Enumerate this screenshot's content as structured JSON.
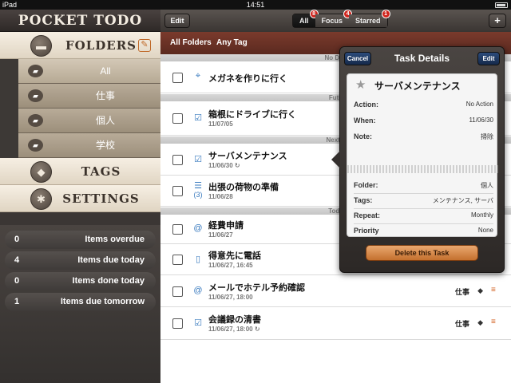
{
  "status": {
    "carrier": "iPad",
    "time": "14:51",
    "battery": ""
  },
  "app": {
    "title": "POCKET TODO"
  },
  "sidebar": {
    "folders_label": "FOLDERS",
    "folders": [
      {
        "label": "All",
        "selected": true
      },
      {
        "label": "仕事"
      },
      {
        "label": "個人"
      },
      {
        "label": "学校"
      }
    ],
    "tags_label": "TAGS",
    "settings_label": "SETTINGS",
    "stats": [
      {
        "count": "0",
        "label": "Items overdue"
      },
      {
        "count": "4",
        "label": "Items due today"
      },
      {
        "count": "0",
        "label": "Items done today"
      },
      {
        "count": "1",
        "label": "Items due tomorrow"
      }
    ]
  },
  "toolbar": {
    "edit_label": "Edit",
    "tabs": [
      {
        "label": "All",
        "badge": "8",
        "selected": true
      },
      {
        "label": "Focus",
        "badge": "4"
      },
      {
        "label": "Starred",
        "badge": "1"
      }
    ],
    "add_label": "+"
  },
  "filter": {
    "folder": "All Folders",
    "tag": "Any Tag"
  },
  "sections": {
    "no_due": "No Due",
    "future": "Futu",
    "next7": "Next 7",
    "today": "Toda"
  },
  "tasks": [
    {
      "title": "メガネを作りに行く",
      "date": "",
      "icon": "⌖"
    },
    {
      "title": "箱根にドライブに行く",
      "date": "11/07/05",
      "icon": "☑"
    },
    {
      "title": "サーバメンテナンス",
      "date": "11/06/30 ↻",
      "icon": "☑"
    },
    {
      "title": "出張の荷物の準備",
      "date": "11/06/28",
      "icon": "☰",
      "sub": "(3)"
    },
    {
      "title": "経費申請",
      "date": "11/06/27",
      "icon": "@"
    },
    {
      "title": "得意先に電話",
      "date": "11/06/27, 16:45",
      "icon": "▯"
    },
    {
      "title": "メールでホテル予約確認",
      "date": "11/06/27, 18:00",
      "icon": "@",
      "tag": "仕事"
    },
    {
      "title": "会議録の清書",
      "date": "11/06/27, 18:00 ↻",
      "icon": "☑",
      "tag": "仕事"
    }
  ],
  "popover": {
    "title": "Task Details",
    "cancel_label": "Cancel",
    "edit_label": "Edit",
    "task_title": "サーバメンテナンス",
    "fields_top": [
      {
        "key": "Action:",
        "value": "No Action"
      },
      {
        "key": "When:",
        "value": "11/06/30"
      },
      {
        "key": "Note:",
        "value": "掃除"
      }
    ],
    "fields_bottom": [
      {
        "key": "Folder:",
        "value": "個人"
      },
      {
        "key": "Tags:",
        "value": "メンテナンス, サーバ"
      },
      {
        "key": "Repeat:",
        "value": "Monthly"
      },
      {
        "key": "Priority",
        "value": "None"
      }
    ],
    "delete_label": "Delete this Task"
  },
  "colors": {
    "accent": "#c4702e",
    "header_bar": "#5b2a20",
    "priority": "#d05a18",
    "badge": "#d0241c"
  }
}
